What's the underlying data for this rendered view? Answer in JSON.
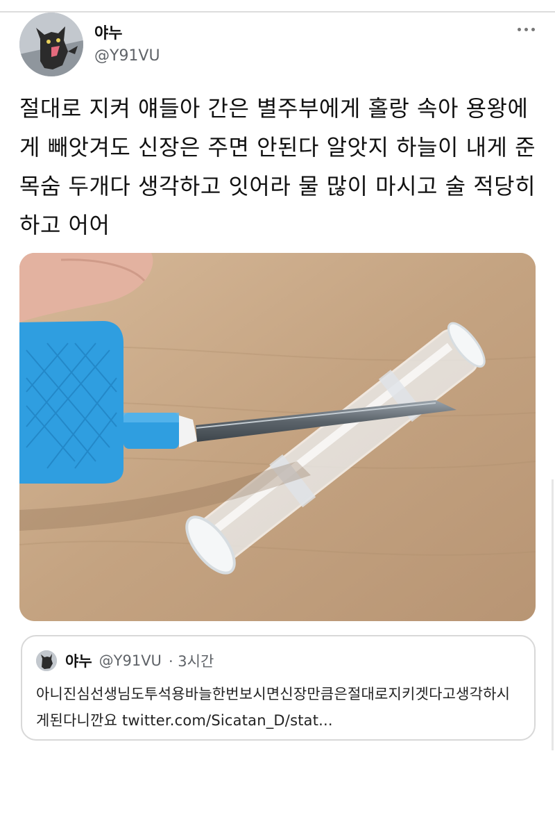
{
  "author": {
    "display_name": "야누",
    "handle": "@Y91VU"
  },
  "tweet": {
    "text": "절대로 지켜 얘들아 간은 별주부에게 홀랑 속아 용왕에게 빼앗겨도 신장은 주면 안된다 알앗지 하늘이 내게 준 목숨 두개다 생각하고 잇어라 물 많이 마시고 술 적당히 하고 어어"
  },
  "quoted_tweet": {
    "display_name": "야누",
    "handle": "@Y91VU",
    "time": "· 3시간",
    "text": "아니진심선생님도투석용바늘한번보시면신장만큼은절대로지키겟다고생각하시게된다니깐요 twitter.com/Sicatan_D/stat..."
  },
  "icons": {
    "more": "more-horizontal-icon"
  }
}
